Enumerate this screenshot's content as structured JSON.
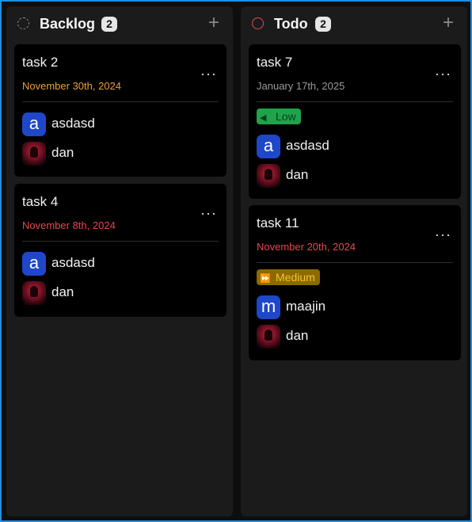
{
  "columns": [
    {
      "title": "Backlog",
      "count": "2",
      "cards": [
        {
          "title": "task 2",
          "date": "November 30th, 2024",
          "date_color": "#e8a13a",
          "assignees": [
            {
              "name": "asdasd",
              "avatar_letter": "a",
              "avatar_type": "letter"
            },
            {
              "name": "dan",
              "avatar_type": "photo"
            }
          ]
        },
        {
          "title": "task 4",
          "date": "November 8th, 2024",
          "date_color": "#e5484d",
          "assignees": [
            {
              "name": "asdasd",
              "avatar_letter": "a",
              "avatar_type": "letter"
            },
            {
              "name": "dan",
              "avatar_type": "photo"
            }
          ]
        }
      ]
    },
    {
      "title": "Todo",
      "count": "2",
      "cards": [
        {
          "title": "task 7",
          "date": "January 17th, 2025",
          "date_color": "#9a9a9a",
          "priority": {
            "label": "Low",
            "icon": "signal-low-icon",
            "color": "#1fa34a"
          },
          "assignees": [
            {
              "name": "asdasd",
              "avatar_letter": "a",
              "avatar_type": "letter"
            },
            {
              "name": "dan",
              "avatar_type": "photo"
            }
          ]
        },
        {
          "title": "task 11",
          "date": "November 20th, 2024",
          "date_color": "#e5484d",
          "priority": {
            "label": "Medium",
            "icon": "fast-forward-icon",
            "color": "#8c6a00"
          },
          "assignees": [
            {
              "name": "maajin",
              "avatar_letter": "m",
              "avatar_type": "letter"
            },
            {
              "name": "dan",
              "avatar_type": "photo"
            }
          ]
        }
      ]
    }
  ],
  "colors": {
    "frame_border": "#1e8fe0",
    "column_bg": "#1b1b1b",
    "card_bg": "#000000",
    "avatar_bg": "#1f47c9"
  },
  "icons": {
    "backlog_status": "dashed-circle-icon",
    "todo_status": "circle-icon",
    "add": "plus-icon",
    "more": "ellipsis-icon"
  }
}
